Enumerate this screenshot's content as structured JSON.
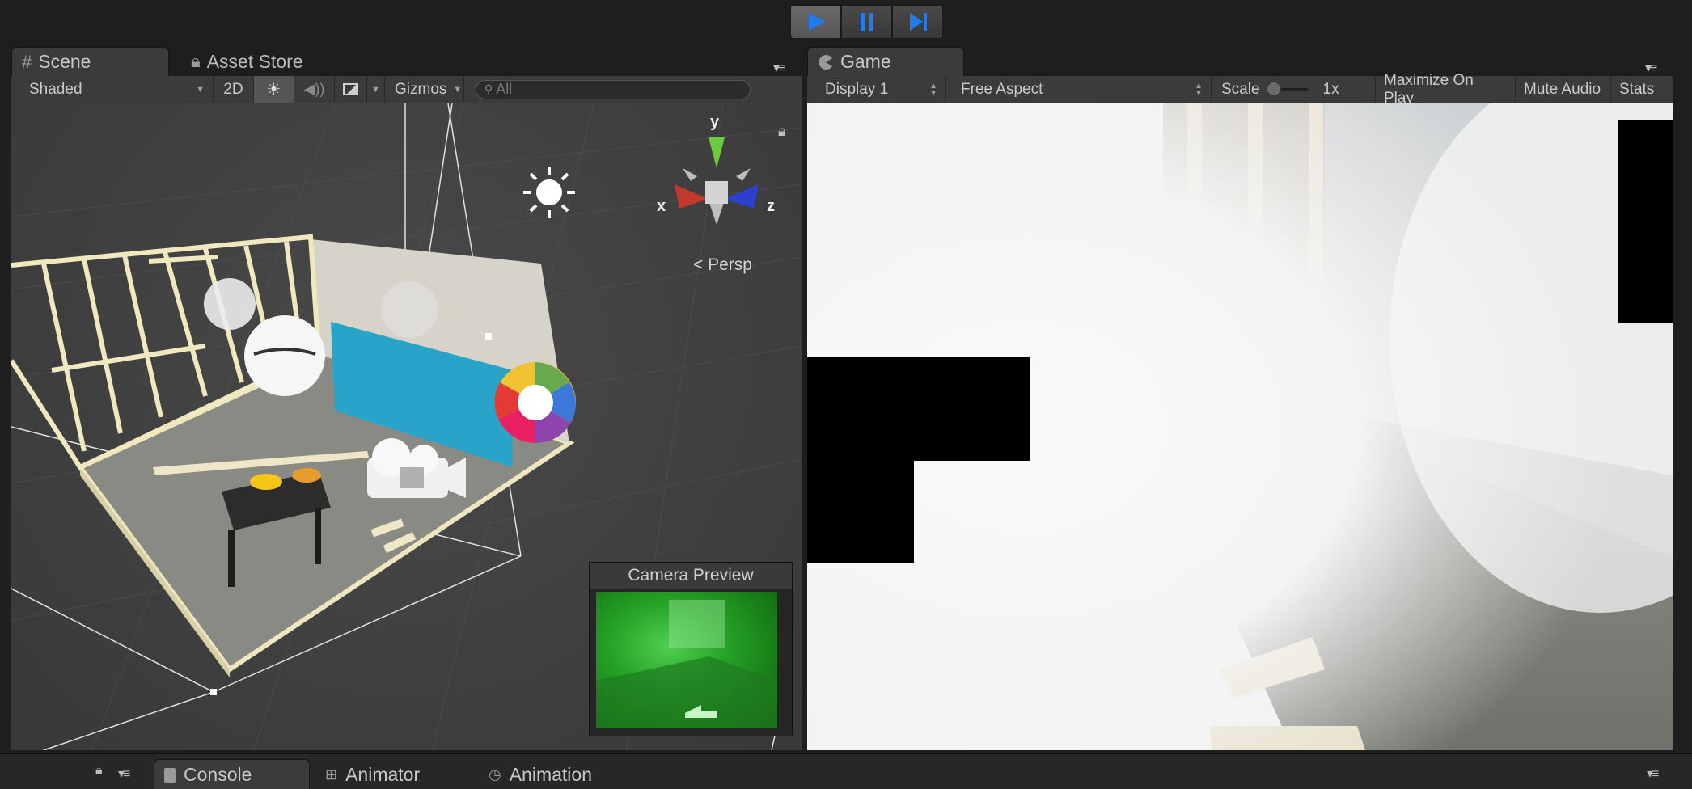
{
  "toolbar": {
    "play_icon": "play-icon",
    "pause_icon": "pause-icon",
    "step_icon": "step-icon"
  },
  "scene_panel": {
    "tabs": [
      {
        "label": "Scene",
        "icon": "scene-hash-icon"
      },
      {
        "label": "Asset Store",
        "icon": "lock-icon"
      }
    ],
    "draw_mode": "Shaded",
    "mode_2d": "2D",
    "gizmos": "Gizmos",
    "search_placeholder": "All",
    "persp_label": "Persp",
    "axis_labels": {
      "y": "y",
      "x": "x",
      "z": "z"
    },
    "camera_preview_title": "Camera Preview"
  },
  "game_panel": {
    "tab_label": "Game",
    "display": "Display 1",
    "aspect": "Free Aspect",
    "scale_label": "Scale",
    "scale_value": "1x",
    "maximize_on_play": "Maximize On Play",
    "mute_audio": "Mute Audio",
    "stats": "Stats"
  },
  "bottom_panel": {
    "tabs": [
      {
        "label": "Console",
        "icon": "console-icon"
      },
      {
        "label": "Animator",
        "icon": "animator-icon"
      },
      {
        "label": "Animation",
        "icon": "clock-icon"
      }
    ]
  },
  "colors": {
    "accent_blue": "#1e6fd9",
    "panel_bg": "#3b3b3b",
    "window_bg": "#1e1e1e"
  }
}
